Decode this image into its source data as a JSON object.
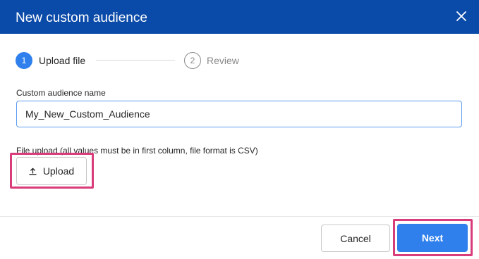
{
  "dialog": {
    "title": "New custom audience",
    "close_icon": "close-icon"
  },
  "steps": [
    {
      "number": "1",
      "label": "Upload file",
      "state": "active"
    },
    {
      "number": "2",
      "label": "Review",
      "state": "inactive"
    }
  ],
  "form": {
    "name_label": "Custom audience name",
    "name_value": "My_New_Custom_Audience",
    "upload_label": "File upload (all values must be in first column, file format is CSV)",
    "upload_button_label": "Upload",
    "upload_icon": "upload-icon"
  },
  "footer": {
    "cancel_label": "Cancel",
    "next_label": "Next"
  },
  "colors": {
    "header": "#0a4aa8",
    "primary": "#2f80ed",
    "highlight": "#d93c7a"
  }
}
